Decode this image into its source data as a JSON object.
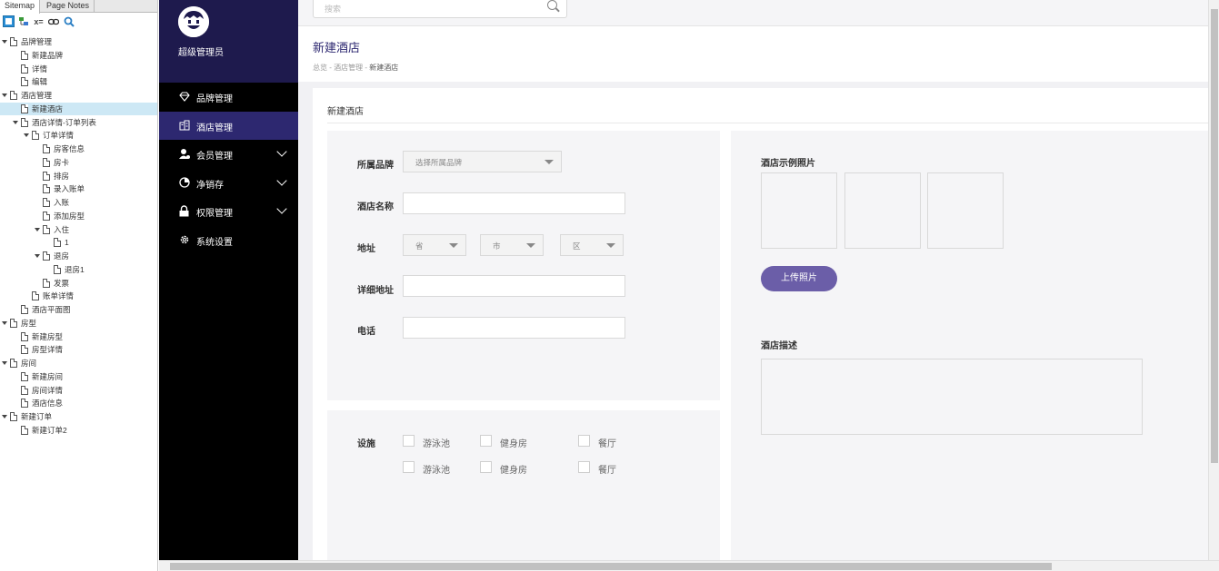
{
  "sitemap": {
    "tabs": [
      {
        "label": "Sitemap",
        "active": true
      },
      {
        "label": "Page Notes",
        "active": false
      }
    ],
    "toolbar_icons": [
      "add-page-icon",
      "add-folder-icon",
      "delete-icon",
      "link-icon",
      "search-icon"
    ],
    "tree": [
      {
        "label": "品牌管理",
        "level": 0,
        "expanded": true
      },
      {
        "label": "新建品牌",
        "level": 1
      },
      {
        "label": "详情",
        "level": 1
      },
      {
        "label": "编辑",
        "level": 1
      },
      {
        "label": "酒店管理",
        "level": 0,
        "expanded": true
      },
      {
        "label": "新建酒店",
        "level": 1,
        "selected": true
      },
      {
        "label": "酒店详情-订单列表",
        "level": 1,
        "expanded": true
      },
      {
        "label": "订单详情",
        "level": 2,
        "expanded": true
      },
      {
        "label": "房客信息",
        "level": 3
      },
      {
        "label": "房卡",
        "level": 3
      },
      {
        "label": "排房",
        "level": 3
      },
      {
        "label": "录入账单",
        "level": 3
      },
      {
        "label": "入账",
        "level": 3
      },
      {
        "label": "添加房型",
        "level": 3
      },
      {
        "label": "入住",
        "level": 3,
        "expanded": true
      },
      {
        "label": "1",
        "level": 4
      },
      {
        "label": "退房",
        "level": 3,
        "expanded": true
      },
      {
        "label": "退房1",
        "level": 4
      },
      {
        "label": "发票",
        "level": 3
      },
      {
        "label": "账单详情",
        "level": 2
      },
      {
        "label": "酒店平面图",
        "level": 1
      },
      {
        "label": "房型",
        "level": 0,
        "expanded": true
      },
      {
        "label": "新建房型",
        "level": 1
      },
      {
        "label": "房型详情",
        "level": 1
      },
      {
        "label": "房间",
        "level": 0,
        "expanded": true
      },
      {
        "label": "新建房间",
        "level": 1
      },
      {
        "label": "房间详情",
        "level": 1
      },
      {
        "label": "酒店信息",
        "level": 1
      },
      {
        "label": "新建订单",
        "level": 0,
        "expanded": true
      },
      {
        "label": "新建订单2",
        "level": 1
      }
    ]
  },
  "admin": {
    "username": "超级管理员",
    "nav": [
      {
        "label": "品牌管理",
        "icon": "diamond-icon",
        "active": false,
        "has_children": false
      },
      {
        "label": "酒店管理",
        "icon": "building-icon",
        "active": true,
        "has_children": false
      },
      {
        "label": "会员管理",
        "icon": "member-icon",
        "active": false,
        "has_children": true
      },
      {
        "label": "净销存",
        "icon": "pie-chart-icon",
        "active": false,
        "has_children": true
      },
      {
        "label": "权限管理",
        "icon": "lock-icon",
        "active": false,
        "has_children": true
      },
      {
        "label": "系统设置",
        "icon": "gear-icon",
        "active": false,
        "has_children": false
      }
    ]
  },
  "search": {
    "placeholder": "搜索"
  },
  "page": {
    "title": "新建酒店",
    "breadcrumb": {
      "home": "总览",
      "sep1": " - ",
      "parent": "酒店管理",
      "sep2": " - ",
      "current": "新建酒店"
    },
    "section_title": "新建酒店"
  },
  "form": {
    "brand_label": "所属品牌",
    "brand_placeholder": "选择所属品牌",
    "name_label": "酒店名称",
    "name_value": "",
    "address_label": "地址",
    "province": "省",
    "city": "市",
    "district": "区",
    "detail_address_label": "详细地址",
    "detail_address_value": "",
    "phone_label": "电话",
    "phone_value": ""
  },
  "facilities": {
    "label": "设施",
    "options": [
      {
        "label": "游泳池",
        "checked": false
      },
      {
        "label": "健身房",
        "checked": false
      },
      {
        "label": "餐厅",
        "checked": false
      },
      {
        "label": "游泳池",
        "checked": false
      },
      {
        "label": "健身房",
        "checked": false
      },
      {
        "label": "餐厅",
        "checked": false
      }
    ]
  },
  "photos": {
    "label": "酒店示例照片",
    "upload_label": "上传照片",
    "count": 3
  },
  "description": {
    "label": "酒店描述",
    "value": ""
  },
  "colors": {
    "sidebar_bg": "#000000",
    "profile_bg": "#1e1a4d",
    "nav_active": "#2d2870",
    "accent": "#6b5ea8",
    "tree_selected": "#cde8f5"
  }
}
